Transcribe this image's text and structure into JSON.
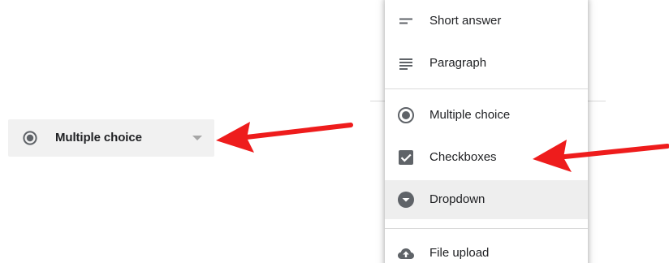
{
  "colors": {
    "accent_red": "#ee1c1c",
    "icon_gray": "#5f6368",
    "select_bg": "#f1f1f1",
    "selected_item_bg": "#eeeeee"
  },
  "question_type_select": {
    "icon": "radio-button-checked-icon",
    "selected_label": "Multiple choice",
    "caret_icon": "caret-down-icon"
  },
  "type_menu": {
    "items": [
      {
        "label": "Short answer",
        "icon": "short-text-icon",
        "selected": false
      },
      {
        "label": "Paragraph",
        "icon": "paragraph-icon",
        "selected": false
      },
      {
        "label": "Multiple choice",
        "icon": "radio-button-checked-icon",
        "selected": false
      },
      {
        "label": "Checkboxes",
        "icon": "checkbox-checked-icon",
        "selected": false
      },
      {
        "label": "Dropdown",
        "icon": "dropdown-circle-icon",
        "selected": true
      },
      {
        "label": "File upload",
        "icon": "cloud-upload-icon",
        "selected": false
      }
    ]
  },
  "annotations": [
    {
      "name": "arrow-to-select",
      "points_to": "question_type_select"
    },
    {
      "name": "arrow-to-checkboxes",
      "points_to": "Checkboxes"
    }
  ]
}
